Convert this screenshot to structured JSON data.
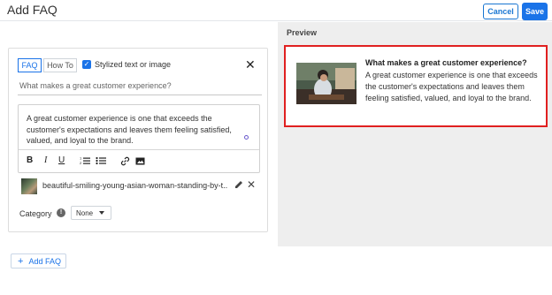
{
  "header": {
    "title": "Add FAQ",
    "cancel_label": "Cancel",
    "save_label": "Save"
  },
  "editor": {
    "tabs": [
      "FAQ",
      "How To"
    ],
    "stylized_label": "Stylized text or image",
    "stylized_checked": true,
    "question": "What makes a great customer experience?",
    "answer": "A great customer experience is one that exceeds the customer's expectations and leaves them feeling satisfied, valued, and loyal to the brand.",
    "toolbar": {
      "bold": "B",
      "italic": "I",
      "underline": "U"
    },
    "attachment": {
      "filename": "beautiful-smiling-young-asian-woman-standing-by-t..."
    },
    "category": {
      "label": "Category",
      "value": "None"
    }
  },
  "add_faq_label": "Add FAQ",
  "preview": {
    "label": "Preview",
    "question": "What makes a great customer experience?",
    "answer": "A great customer experience is one that exceeds the customer's expectations and leaves them feeling satisfied, valued, and loyal to the brand."
  },
  "colors": {
    "accent": "#1a73e8",
    "highlight": "#e02020",
    "preview_bg": "#eeeeee"
  }
}
